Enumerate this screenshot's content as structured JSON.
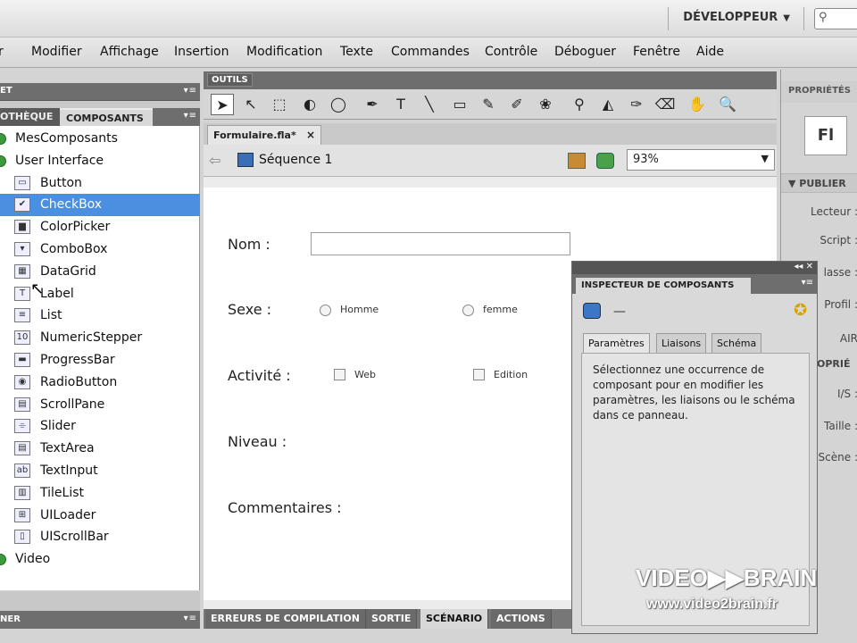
{
  "topbar": {
    "workspace_label": "DÉVELOPPEUR",
    "search_icon": "⚲"
  },
  "menubar": {
    "items": [
      "r",
      "Modifier",
      "Affichage",
      "Insertion",
      "Modification",
      "Texte",
      "Commandes",
      "Contrôle",
      "Déboguer",
      "Fenêtre",
      "Aide"
    ]
  },
  "left_panel": {
    "top_header_title": "ET",
    "tabs": [
      "OTHÈQUE",
      "COMPOSANTS"
    ],
    "tree": [
      {
        "label": "MesComposants",
        "type": "folder"
      },
      {
        "label": "User Interface",
        "type": "folder"
      },
      {
        "label": "Button",
        "icon": "▭"
      },
      {
        "label": "CheckBox",
        "icon": "✔",
        "selected": true
      },
      {
        "label": "ColorPicker",
        "icon": "▆"
      },
      {
        "label": "ComboBox",
        "icon": "▾"
      },
      {
        "label": "DataGrid",
        "icon": "▦"
      },
      {
        "label": "Label",
        "icon": "T"
      },
      {
        "label": "List",
        "icon": "≡"
      },
      {
        "label": "NumericStepper",
        "icon": "10"
      },
      {
        "label": "ProgressBar",
        "icon": "▬"
      },
      {
        "label": "RadioButton",
        "icon": "◉"
      },
      {
        "label": "ScrollPane",
        "icon": "▤"
      },
      {
        "label": "Slider",
        "icon": "⌯"
      },
      {
        "label": "TextArea",
        "icon": "▤"
      },
      {
        "label": "TextInput",
        "icon": "ab"
      },
      {
        "label": "TileList",
        "icon": "▥"
      },
      {
        "label": "UILoader",
        "icon": "⊞"
      },
      {
        "label": "UIScrollBar",
        "icon": "▯"
      },
      {
        "label": "Video",
        "type": "folder"
      }
    ],
    "bottom_header_title": "NER"
  },
  "tools": {
    "title": "OUTILS",
    "icons": [
      "selection-tool-icon",
      "subselection-tool-icon",
      "free-transform-icon",
      "3d-rotation-icon",
      "lasso-icon",
      "pen-icon",
      "text-icon",
      "line-icon",
      "rectangle-icon",
      "pencil-icon",
      "brush-icon",
      "deco-icon",
      "bone-icon",
      "paint-bucket-icon",
      "eyedropper-icon",
      "eraser-icon",
      "hand-icon",
      "zoom-icon"
    ],
    "glyphs": [
      "➤",
      "↖",
      "⬚",
      "◐",
      "◯",
      "✒",
      "T",
      "╲",
      "▭",
      "✎",
      "✐",
      "❀",
      "⚲",
      "◭",
      "✑",
      "⌫",
      "✋",
      "🔍"
    ]
  },
  "document": {
    "tab_label": "Formulaire.fla*",
    "tab_close": "×",
    "back_arrow": "⇦",
    "scene_label": "Séquence 1",
    "zoom_value": "93%"
  },
  "form": {
    "nom_label": "Nom :",
    "sexe_label": "Sexe :",
    "homme_label": "Homme",
    "femme_label": "femme",
    "activite_label": "Activité :",
    "web_label": "Web",
    "edition_label": "Edition",
    "niveau_label": "Niveau :",
    "commentaires_label": "Commentaires :"
  },
  "bottom_tabs": [
    "ERREURS DE COMPILATION",
    "SORTIE",
    "SCÉNARIO",
    "ACTIONS"
  ],
  "properties": {
    "header": "PROPRIÉTÉS",
    "logo": "Fl",
    "publier": "▼ PUBLIER",
    "rows": [
      "Lecteur :",
      "Script :",
      "lasse :",
      "Profil :",
      "AIR",
      "I/S :",
      "Taille :",
      "Scène :"
    ],
    "section": "OPRIÉ"
  },
  "inspector": {
    "title": "INSPECTEUR DE COMPOSANTS",
    "dash": "—",
    "tabs": [
      "Paramètres",
      "Liaisons",
      "Schéma"
    ],
    "body_text": "Sélectionnez une occurrence de composant pour en modifier les paramètres, les liaisons ou le schéma dans ce panneau."
  },
  "watermark": {
    "logo": "VIDEO▶▶BRAIN",
    "url": "www.video2brain.fr"
  }
}
